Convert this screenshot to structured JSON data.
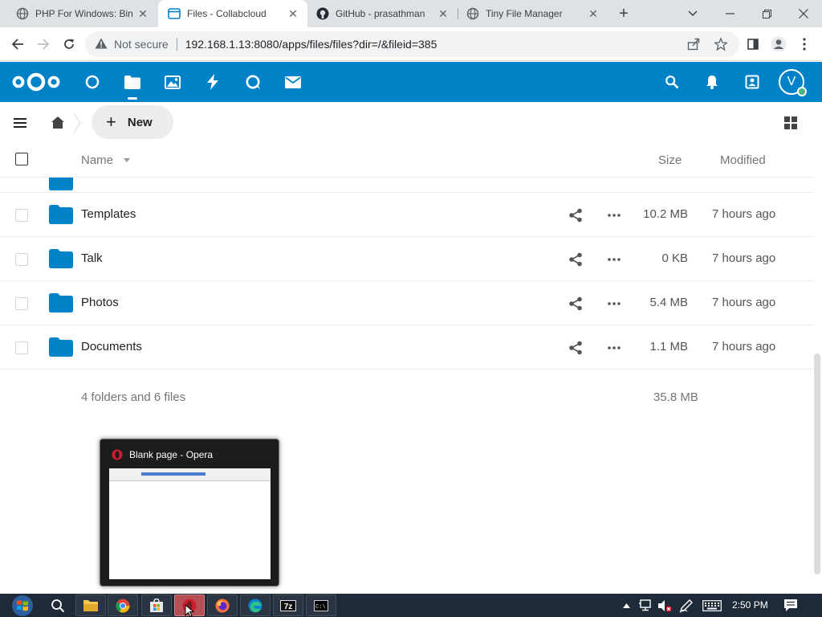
{
  "browser": {
    "tabs": [
      {
        "title": "PHP For Windows: Bin",
        "active": false,
        "favicon": "globe-icon"
      },
      {
        "title": "Files - Collabcloud",
        "active": true,
        "favicon": "files-page-icon"
      },
      {
        "title": "GitHub - prasathman",
        "active": false,
        "favicon": "github-icon"
      },
      {
        "title": "Tiny File Manager",
        "active": false,
        "favicon": "globe-icon"
      }
    ],
    "security_label": "Not secure",
    "url": "192.168.1.13:8080/apps/files/files?dir=/&fileid=385"
  },
  "nextcloud": {
    "brand_color": "#0082c9",
    "apps": [
      "dashboard-icon",
      "files-icon",
      "photos-icon",
      "activity-icon",
      "talk-icon",
      "mail-icon"
    ],
    "avatar_initial": "V"
  },
  "files": {
    "new_label": "New",
    "columns": {
      "name": "Name",
      "size": "Size",
      "modified": "Modified"
    },
    "rows": [
      {
        "name": "Templates",
        "size": "10.2 MB",
        "modified": "7 hours ago"
      },
      {
        "name": "Talk",
        "size": "0 KB",
        "modified": "7 hours ago"
      },
      {
        "name": "Photos",
        "size": "5.4 MB",
        "modified": "7 hours ago"
      },
      {
        "name": "Documents",
        "size": "1.1 MB",
        "modified": "7 hours ago"
      }
    ],
    "summary": {
      "text": "4 folders and 6 files",
      "total_size": "35.8 MB"
    }
  },
  "taskbar_popup": {
    "title": "Blank page - Opera"
  },
  "taskbar": {
    "items": [
      "explorer-icon",
      "chrome-icon",
      "store-icon",
      "opera-icon",
      "firefox-icon",
      "edge-icon",
      "7zip-icon",
      "cmd-icon"
    ],
    "time": "2:50 PM"
  }
}
